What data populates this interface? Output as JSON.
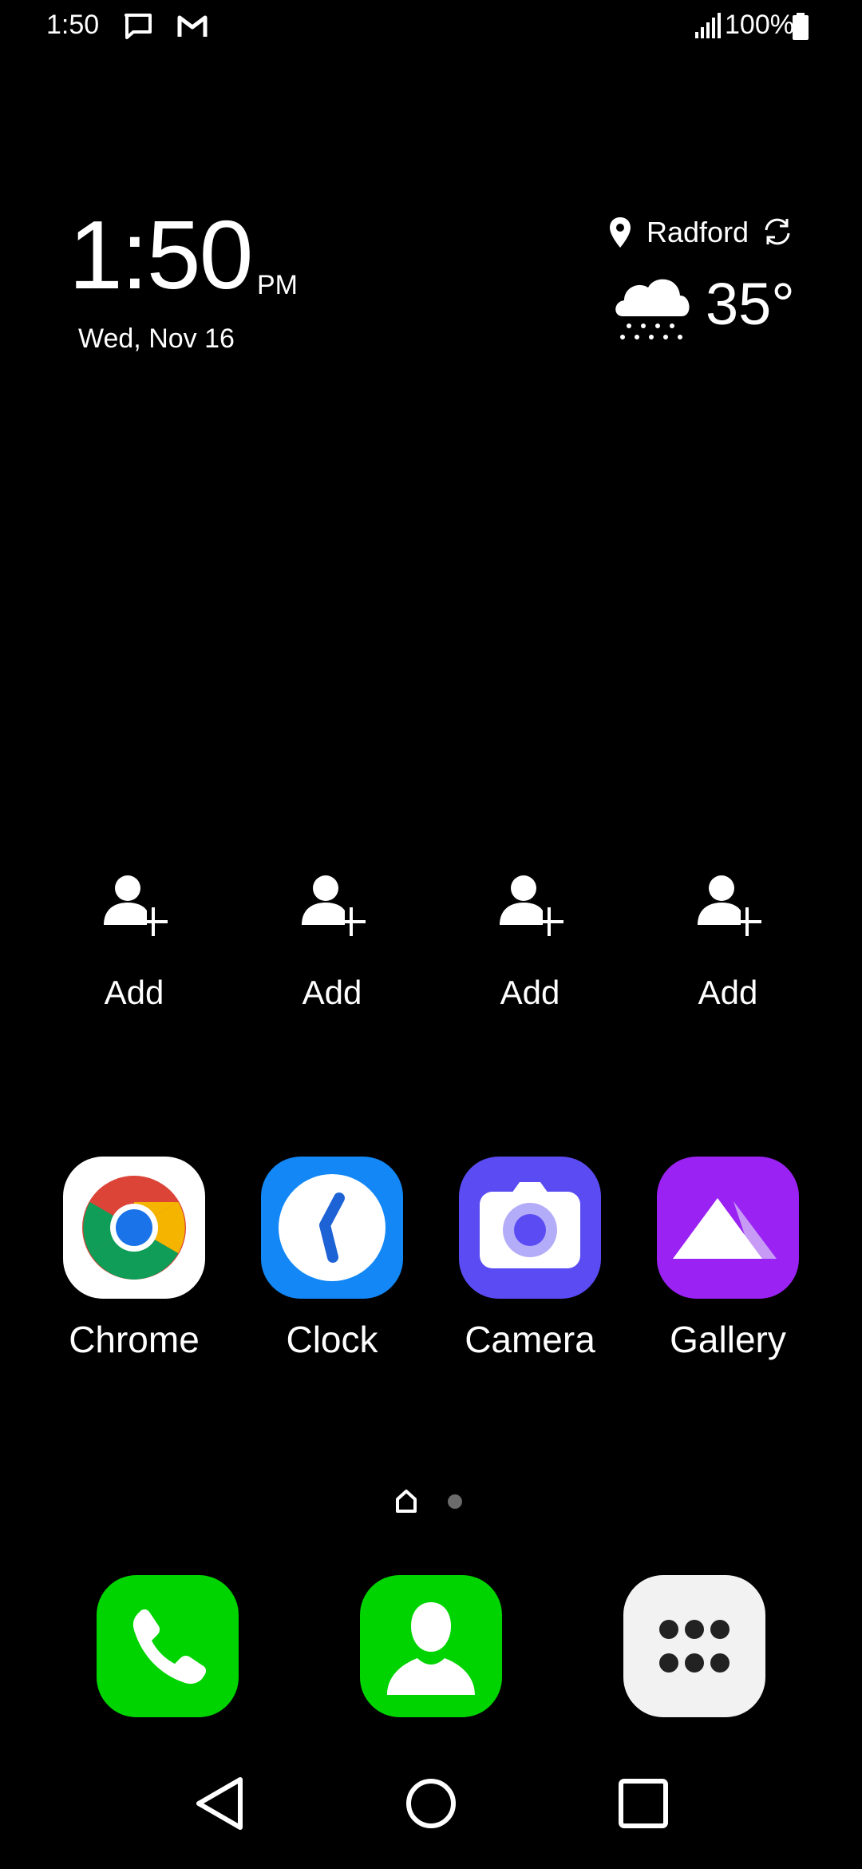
{
  "status_bar": {
    "time": "1:50",
    "battery": "100%"
  },
  "clock_widget": {
    "time": "1:50",
    "ampm": "PM",
    "date": "Wed, Nov 16"
  },
  "weather_widget": {
    "location": "Radford",
    "temperature": "35°",
    "condition_icon": "snow-cloud-icon"
  },
  "contact_shortcuts": [
    {
      "label": "Add"
    },
    {
      "label": "Add"
    },
    {
      "label": "Add"
    },
    {
      "label": "Add"
    }
  ],
  "apps": [
    {
      "label": "Chrome",
      "color": "#FFFFFF"
    },
    {
      "label": "Clock",
      "color": "#1287F5"
    },
    {
      "label": "Camera",
      "color": "#5A4BF2"
    },
    {
      "label": "Gallery",
      "color": "#9A22F2"
    }
  ],
  "dock": [
    {
      "icon": "phone-icon",
      "color": "#00D400"
    },
    {
      "icon": "contacts-icon",
      "color": "#00D400"
    },
    {
      "icon": "app-drawer-icon",
      "color": "#F2F2F2"
    }
  ],
  "page_indicator": {
    "pages": 2,
    "current": 1
  }
}
